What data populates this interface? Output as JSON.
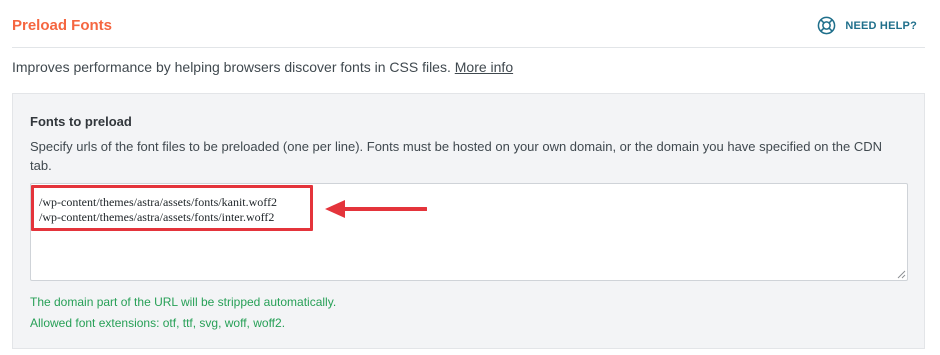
{
  "header": {
    "title": "Preload Fonts",
    "help_label": "NEED HELP?",
    "help_icon": "lifebuoy-icon"
  },
  "description": {
    "text": "Improves performance by helping browsers discover fonts in CSS files.",
    "link": "More info"
  },
  "field": {
    "label": "Fonts to preload",
    "description": "Specify urls of the font files to be preloaded (one per line). Fonts must be hosted on your own domain, or the domain you have specified on the CDN tab.",
    "lines": [
      "/wp-content/themes/astra/assets/fonts/kanit.woff2",
      "/wp-content/themes/astra/assets/fonts/inter.woff2"
    ],
    "notes": [
      "The domain part of the URL will be stripped automatically.",
      "Allowed font extensions: otf, ttf, svg, woff, woff2."
    ]
  },
  "colors": {
    "title": "#f56640",
    "help": "#1f6f8b",
    "note": "#27a057",
    "annotation": "#e4343b"
  }
}
